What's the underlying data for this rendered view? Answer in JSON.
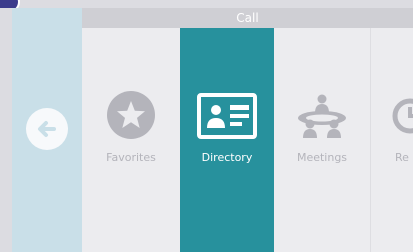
{
  "header": {
    "title": "Call"
  },
  "back": {
    "icon": "arrow-left-icon"
  },
  "menu": {
    "items": [
      {
        "label": "Favorites",
        "icon": "star-icon",
        "selected": false
      },
      {
        "label": "Directory",
        "icon": "contact-card-icon",
        "selected": true
      },
      {
        "label": "Meetings",
        "icon": "meeting-people-icon",
        "selected": false
      },
      {
        "label": "Re",
        "icon": "clock-icon",
        "selected": false
      }
    ]
  },
  "colors": {
    "accent": "#27919d",
    "back_panel": "#c9dfe8",
    "title_bar": "#cfcfd4",
    "icon_gray": "#b4b4bb",
    "badge": "#3c3c8c"
  }
}
